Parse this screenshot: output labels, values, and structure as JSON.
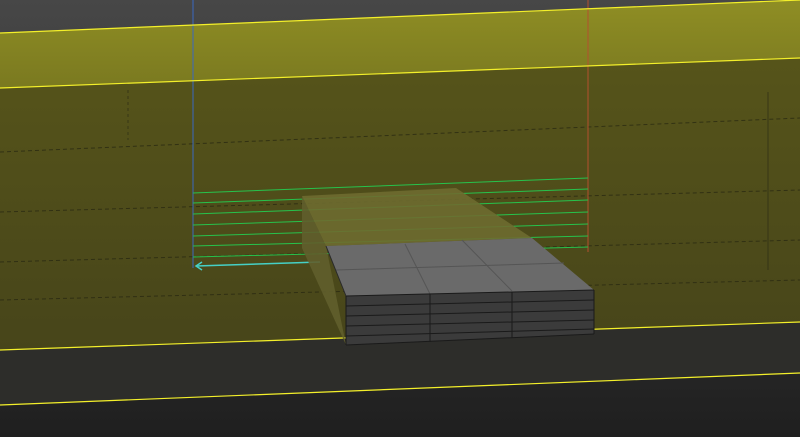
{
  "viewport": {
    "kind": "3d-modeling-viewport",
    "colors": {
      "background_top": "#3c3c3c",
      "background_bottom": "#232323",
      "selection_outline": "#f2f22e",
      "selected_face_top": "#8b8a20",
      "selected_face_body": "#4c4a17",
      "floor_dark": "#2a2a2a",
      "grid_lines": "#22c24a",
      "axis_x": "#b04a2e",
      "axis_y": "#2b6cc8",
      "wire_edges": "#111111",
      "box_top": "#6b6b6b",
      "box_front": "#3d3d3d",
      "cyan_edge": "#3fd4c8"
    },
    "objects": [
      {
        "name": "selected-wall-block",
        "selected": true
      },
      {
        "name": "grid-slab",
        "selected": false
      },
      {
        "name": "extruded-box",
        "selected": false
      }
    ]
  }
}
